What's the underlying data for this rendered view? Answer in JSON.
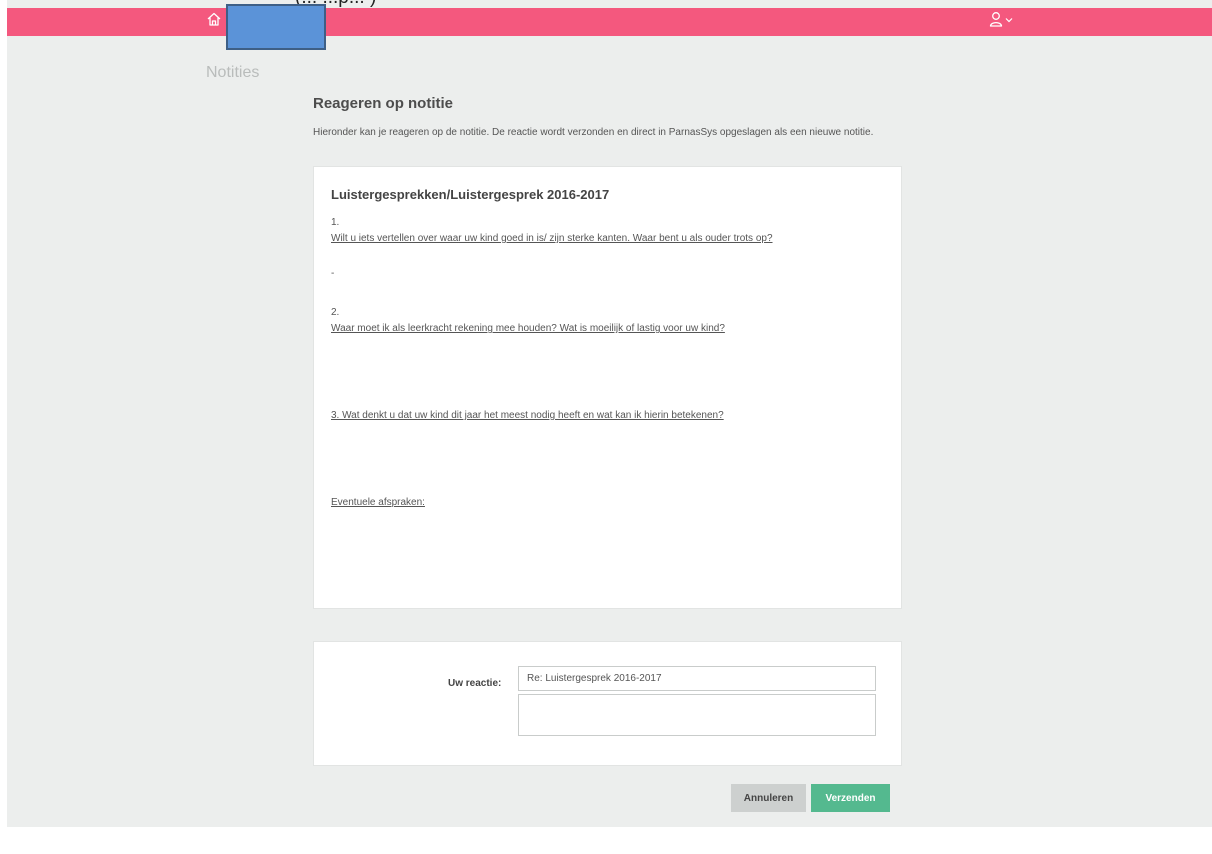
{
  "colors": {
    "topbar": "#f4587e",
    "background": "#eceeed",
    "send_button": "#54b98f",
    "cancel_button": "#cdd0cf",
    "redaction": "#5b93d8"
  },
  "header": {
    "home_icon": "home-icon",
    "user_icon": "user-icon",
    "user_menu_icon": "chevron-down-icon",
    "peek_text": "(... ...p... )"
  },
  "sidebar": {
    "active_item": "Notities"
  },
  "page": {
    "title": "Reageren op notitie",
    "intro": "Hieronder kan je reageren op de notitie. De reactie wordt verzonden en direct in ParnasSys opgeslagen als een nieuwe notitie."
  },
  "note": {
    "title": "Luistergesprekken/Luistergesprek 2016-2017",
    "lines": [
      "1.",
      "Wilt u iets vertellen over waar uw kind goed in is/ zijn sterke kanten. Waar bent u als ouder trots op?",
      "-",
      "2.",
      "Waar moet ik als leerkracht rekening mee houden? Wat is moeilijk of lastig voor uw kind?",
      "3. Wat denkt u dat uw kind dit jaar het meest nodig heeft en wat kan ik hierin betekenen?",
      "Eventuele afspraken:"
    ]
  },
  "reply": {
    "label": "Uw reactie:",
    "subject_value": "Re: Luistergesprek 2016-2017",
    "body_value": ""
  },
  "actions": {
    "cancel_label": "Annuleren",
    "send_label": "Verzenden"
  }
}
